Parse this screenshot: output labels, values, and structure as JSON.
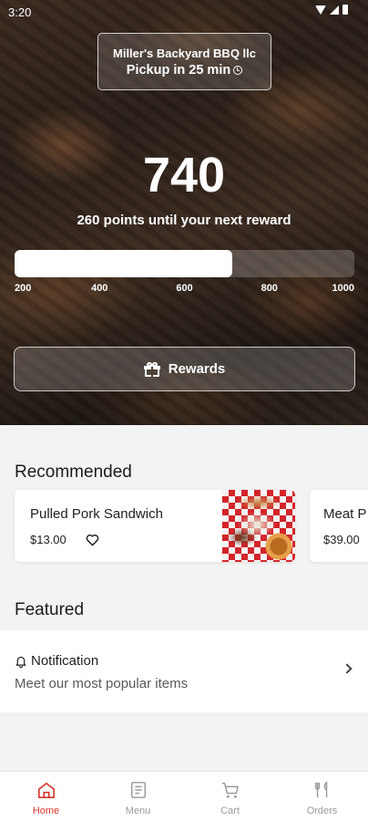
{
  "status_bar": {
    "time": "3:20"
  },
  "store": {
    "name": "Miller's Backyard BBQ llc",
    "pickup": "Pickup in 25 min"
  },
  "rewards": {
    "points": "740",
    "message": "260 points until your next reward",
    "progress_percent": 64,
    "ticks": [
      "200",
      "400",
      "600",
      "800",
      "1000"
    ],
    "button_label": "Rewards"
  },
  "recommended": {
    "title": "Recommended",
    "items": [
      {
        "name": "Pulled Pork Sandwich",
        "price": "$13.00"
      },
      {
        "name": "Meat P",
        "price": "$39.00"
      }
    ]
  },
  "featured": {
    "title": "Featured",
    "notification_title": "Notification",
    "notification_sub": "Meet our most popular items"
  },
  "nav": {
    "items": [
      {
        "label": "Home",
        "icon": "home-icon",
        "active": true
      },
      {
        "label": "Menu",
        "icon": "menu-icon",
        "active": false
      },
      {
        "label": "Cart",
        "icon": "cart-icon",
        "active": false
      },
      {
        "label": "Orders",
        "icon": "orders-icon",
        "active": false
      }
    ]
  },
  "colors": {
    "accent": "#d6342c",
    "inactive": "#9b9b9b"
  }
}
